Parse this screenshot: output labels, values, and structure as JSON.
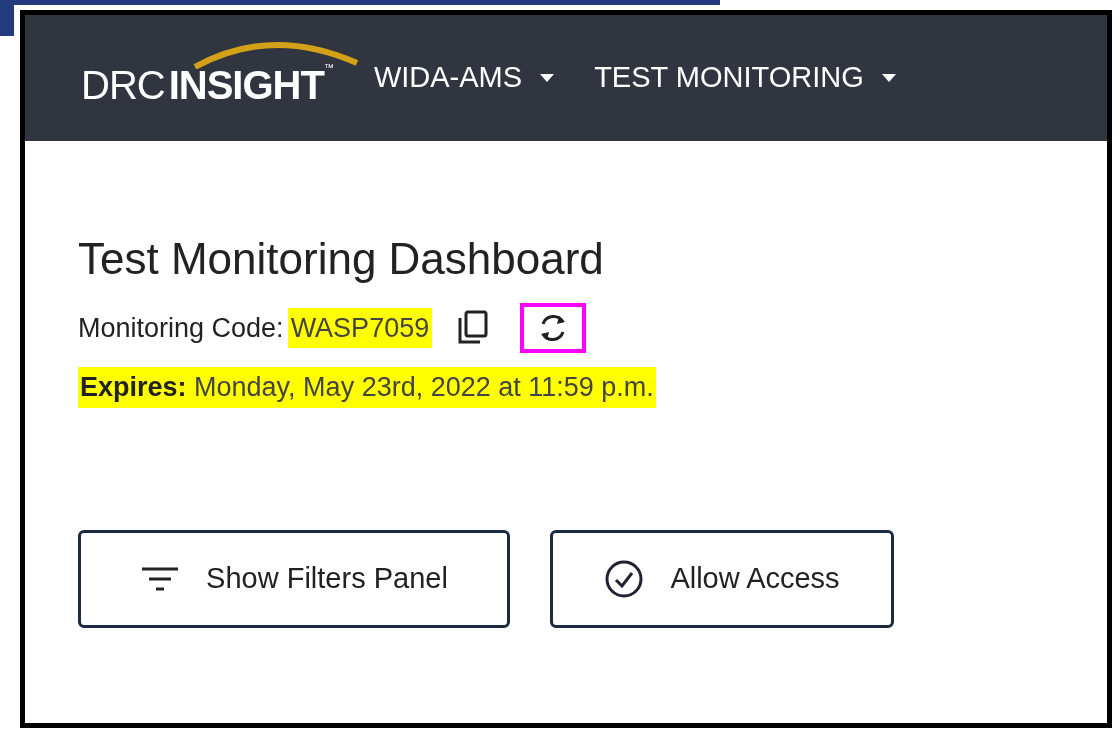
{
  "header": {
    "logo": {
      "part_1": "DRC",
      "part_2": "INSIGHT",
      "mark": "™"
    },
    "nav": [
      {
        "label": "WIDA-AMS"
      },
      {
        "label": "TEST MONITORING"
      }
    ]
  },
  "page": {
    "title": "Test Monitoring Dashboard",
    "code": {
      "label": "Monitoring Code:",
      "value": "WASP7059",
      "highlighted": true,
      "refresh_outlined": true
    },
    "expiry": {
      "label": "Expires:",
      "value": "Monday, May 23rd, 2022 at 11:59 p.m.",
      "highlighted": true
    },
    "buttons": [
      {
        "label": "Show Filters Panel",
        "kind": "filter"
      },
      {
        "label": "Allow Access",
        "kind": "check"
      }
    ]
  }
}
